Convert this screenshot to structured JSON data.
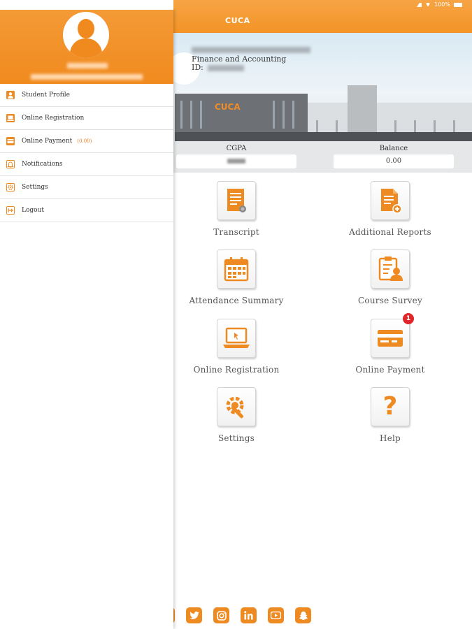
{
  "status_bar": {
    "battery": "100%"
  },
  "app": {
    "title": "CUCA"
  },
  "banner": {
    "program": "Finance and Accounting",
    "id_label": "ID:",
    "sign_text": "CUCA"
  },
  "stats": {
    "cgpa_label": "CGPA",
    "balance_label": "Balance",
    "balance_value": "0.00"
  },
  "tiles": [
    {
      "label": "Transcript",
      "icon": "transcript-icon"
    },
    {
      "label": "Additional Reports",
      "icon": "additional-reports-icon"
    },
    {
      "label": "Attendance Summary",
      "icon": "calendar-icon"
    },
    {
      "label": "Course Survey",
      "icon": "survey-icon"
    },
    {
      "label": "Online Registration",
      "icon": "laptop-icon"
    },
    {
      "label": "Online Payment",
      "icon": "credit-card-icon",
      "badge": "1"
    },
    {
      "label": "Settings",
      "icon": "gear-wrench-icon"
    },
    {
      "label": "Help",
      "icon": "question-icon"
    }
  ],
  "social": [
    "facebook-icon",
    "twitter-icon",
    "instagram-icon",
    "linkedin-icon",
    "youtube-icon",
    "snapchat-icon"
  ],
  "drawer": {
    "menu": [
      {
        "label": "Student Profile",
        "icon": "person-icon"
      },
      {
        "label": "Online Registration",
        "icon": "laptop-icon"
      },
      {
        "label": "Online Payment",
        "icon": "credit-card-icon",
        "extra": "(0.00)"
      },
      {
        "label": "Notifications",
        "icon": "bell-icon"
      },
      {
        "label": "Settings",
        "icon": "gear-icon"
      },
      {
        "label": "Logout",
        "icon": "logout-icon"
      }
    ]
  },
  "colors": {
    "accent": "#F39325",
    "badge": "#E1262B"
  }
}
